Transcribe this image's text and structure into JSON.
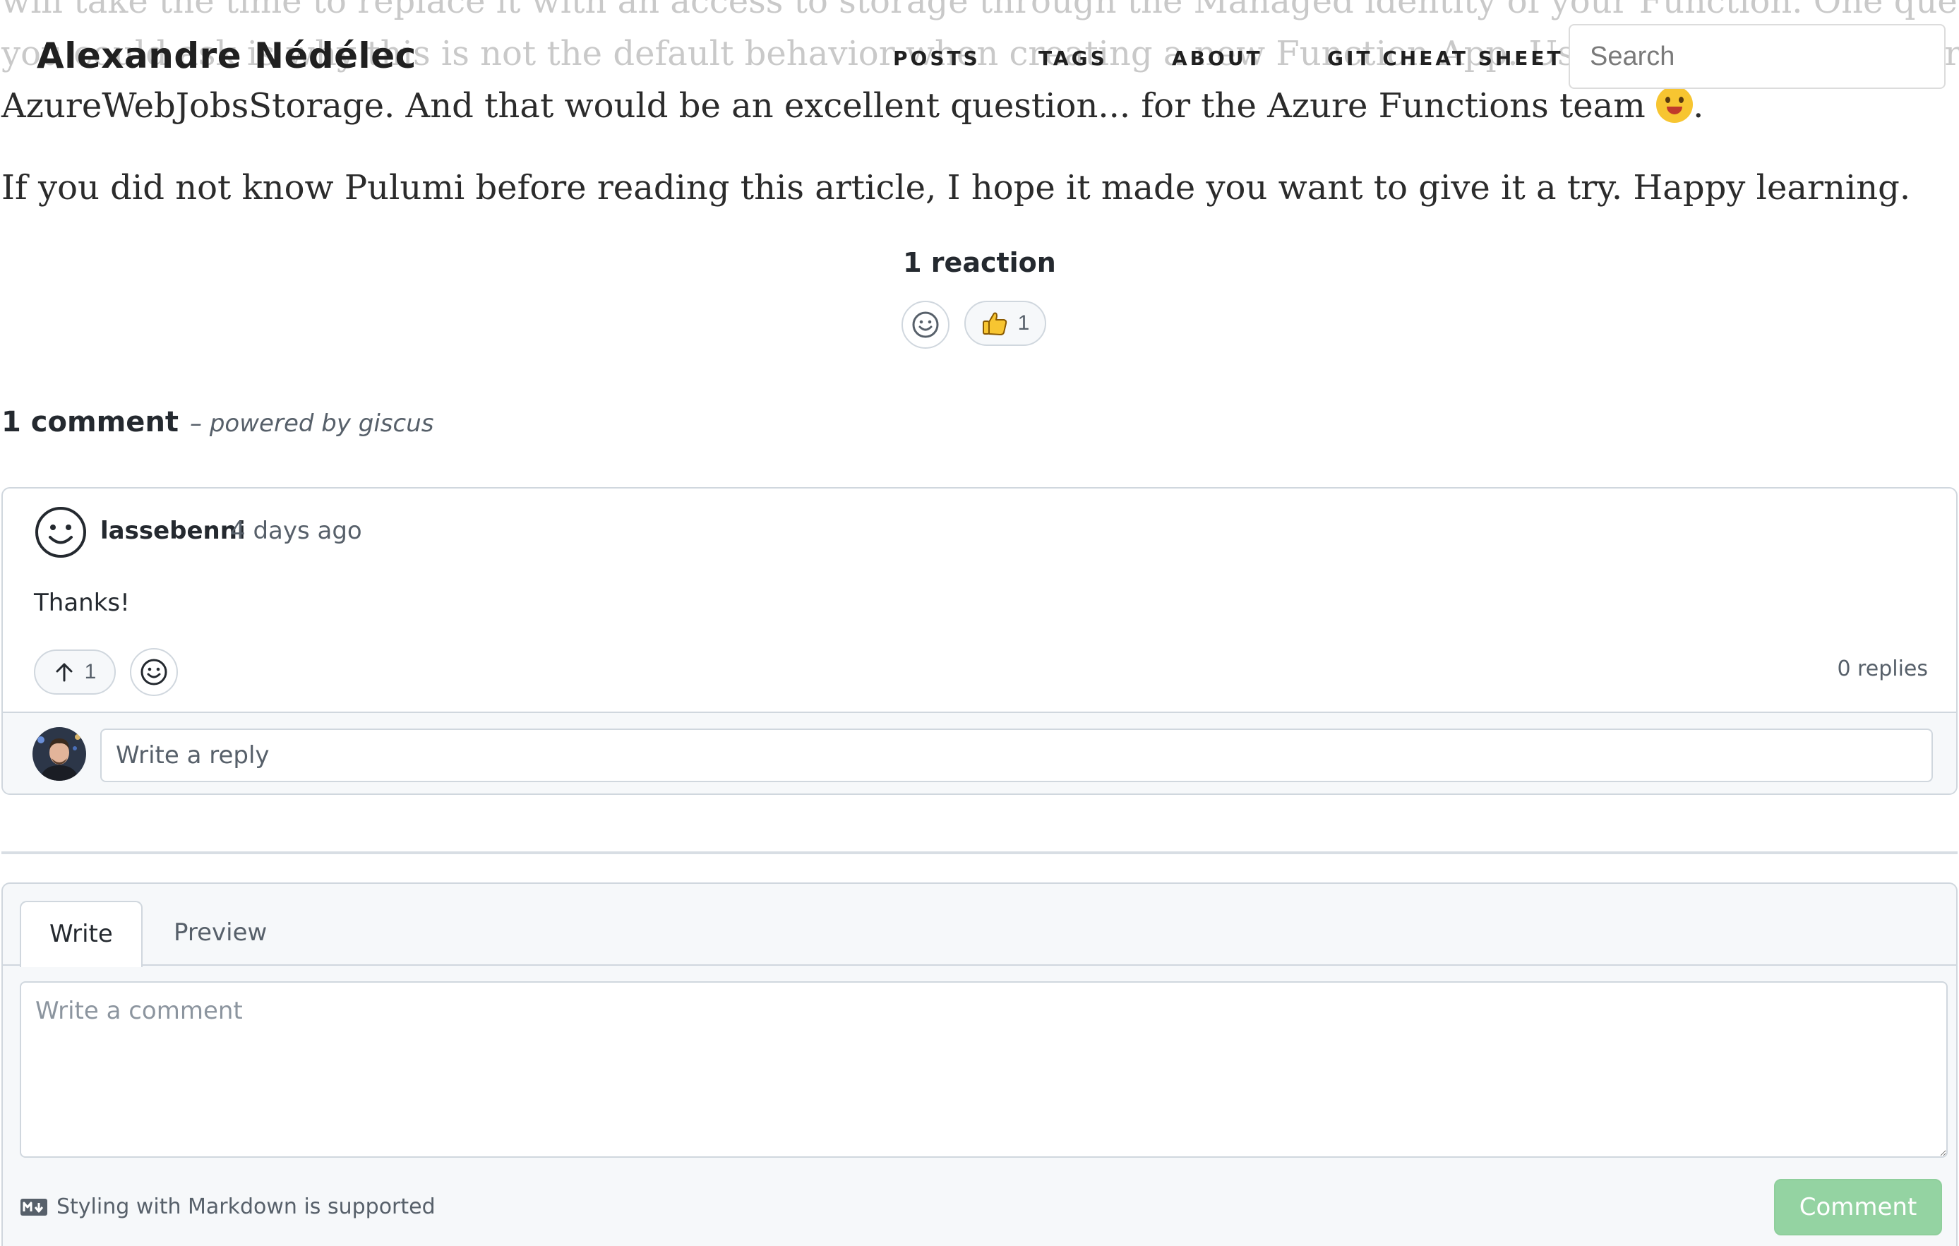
{
  "article": {
    "line1": "will take the time to replace it with an access to storage through the Managed identity of your Function. One question",
    "line2": "you could ask is why this is not the default behavior when creating a new Function App. Using AzureWebJobsStorage",
    "line3": "AzureWebJobsStorage. And that would be an excellent question... for the Azure Functions team",
    "line3_end": ".",
    "line3_emoji": "grinning-face-icon",
    "closing": "If you did not know Pulumi before reading this article, I hope it made you want to give it a try. Happy learning."
  },
  "header": {
    "brand": "Alexandre Nédélec",
    "nav": {
      "posts": "POSTS",
      "tags": "TAGS",
      "about": "ABOUT",
      "git": "GIT CHEAT SHEET"
    },
    "search_placeholder": "Search"
  },
  "reactions": {
    "summary": "1 reaction",
    "add_icon": "smiley-icon",
    "thumbs_icon": "thumbs-up-icon",
    "thumbs_count": "1"
  },
  "comments": {
    "count_label": "1 comment",
    "powered_label": "– powered by giscus",
    "items": [
      {
        "author": "lassebenni",
        "time": "4 days ago",
        "body": "Thanks!",
        "upvotes": "1",
        "replies": "0 replies",
        "reply_placeholder": "Write a reply"
      }
    ]
  },
  "editor": {
    "tab_write": "Write",
    "tab_preview": "Preview",
    "placeholder": "Write a comment",
    "markdown_note": "Styling with Markdown is supported",
    "submit": "Comment"
  },
  "colors": {
    "accent_green": "#94d3a2",
    "border": "#d0d7de",
    "muted_text": "#57606a",
    "thumb_yellow": "#f7c531"
  }
}
